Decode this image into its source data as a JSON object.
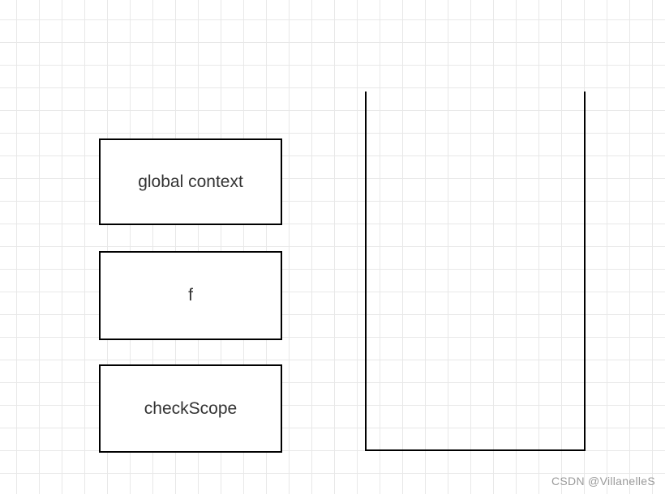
{
  "boxes": {
    "global_context": "global context",
    "f": "f",
    "check_scope": "checkScope"
  },
  "watermark": "CSDN @VillanelleS"
}
